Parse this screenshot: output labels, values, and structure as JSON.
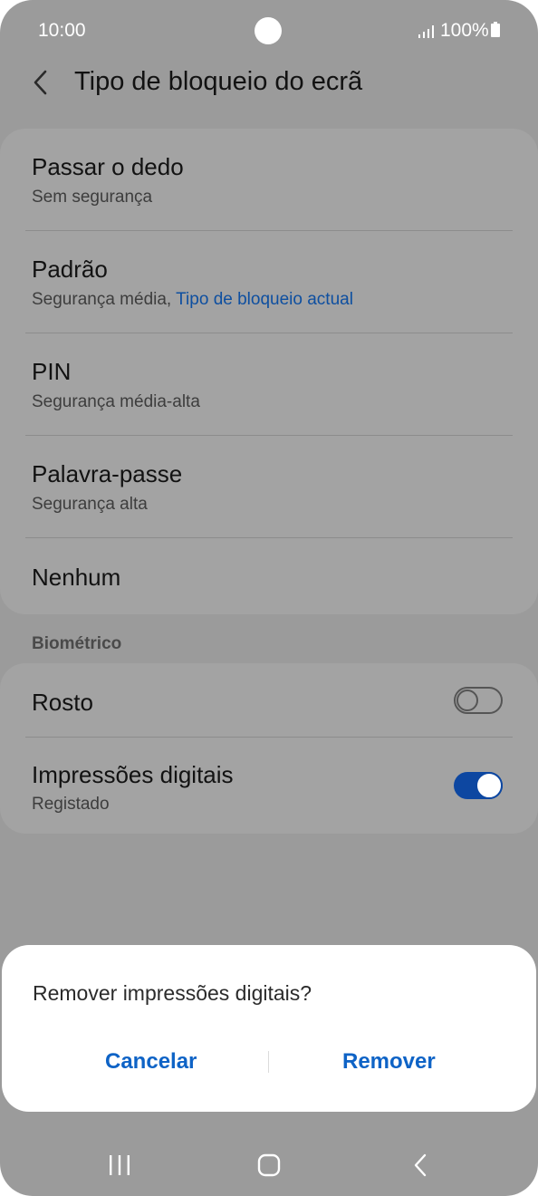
{
  "status": {
    "time": "10:00",
    "battery": "100%"
  },
  "header": {
    "title": "Tipo de bloqueio do ecrã"
  },
  "lock_types": [
    {
      "title": "Passar o dedo",
      "subtitle": "Sem segurança"
    },
    {
      "title": "Padrão",
      "subtitle": "Segurança média, ",
      "subtitle_current": "Tipo de bloqueio actual"
    },
    {
      "title": "PIN",
      "subtitle": "Segurança média-alta"
    },
    {
      "title": "Palavra-passe",
      "subtitle": "Segurança alta"
    },
    {
      "title": "Nenhum"
    }
  ],
  "biometric": {
    "section_label": "Biométrico",
    "face": {
      "title": "Rosto",
      "enabled": false
    },
    "fingerprints": {
      "title": "Impressões digitais",
      "subtitle": "Registado",
      "enabled": true
    }
  },
  "dialog": {
    "title": "Remover impressões digitais?",
    "cancel_label": "Cancelar",
    "remove_label": "Remover"
  },
  "nav": {
    "icons": [
      "recent-apps-icon",
      "home-icon",
      "back-icon"
    ]
  },
  "colors": {
    "accent": "#0e63c6",
    "toggle_on": "#0d47a1",
    "dim_bg": "#9b9b9b"
  }
}
